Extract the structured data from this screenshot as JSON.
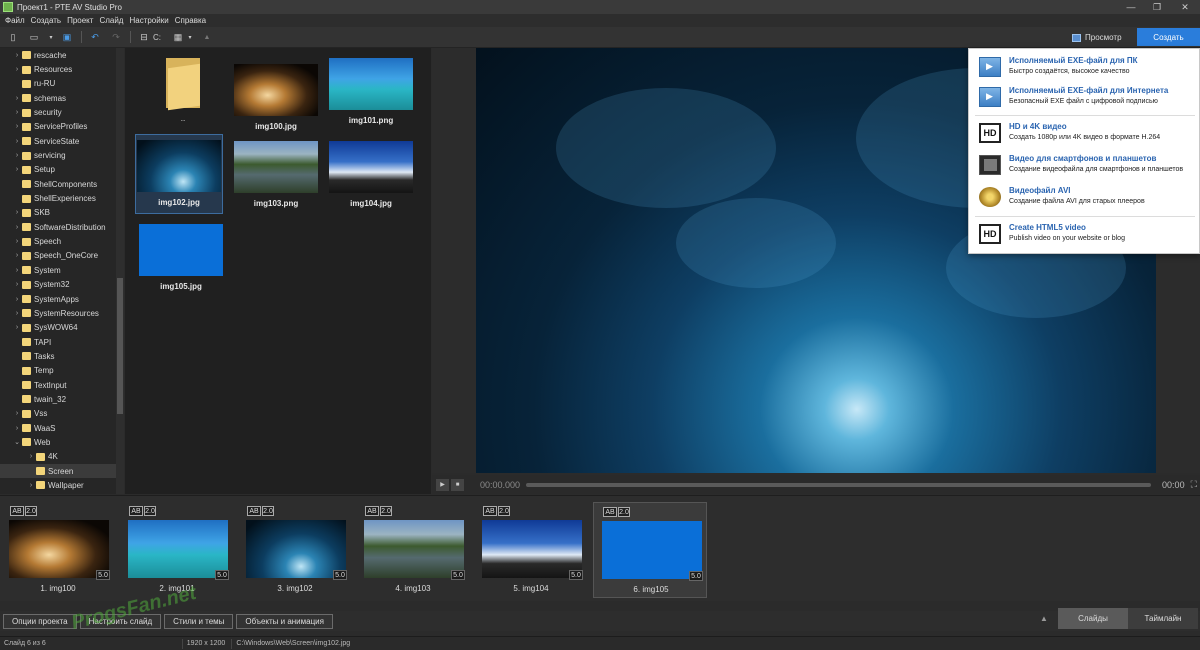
{
  "window": {
    "title": "Проект1 - PTE AV Studio Pro",
    "controls": [
      "—",
      "❐",
      "✕"
    ]
  },
  "menu": [
    "Файл",
    "Создать",
    "Проект",
    "Слайд",
    "Настройки",
    "Справка"
  ],
  "toolbar": {
    "drive_label": "C:",
    "preview_label": "Просмотр",
    "create_label": "Создать"
  },
  "tree": {
    "items": [
      {
        "label": "rescache",
        "arrow": "›"
      },
      {
        "label": "Resources",
        "arrow": "›"
      },
      {
        "label": "ru-RU",
        "arrow": ""
      },
      {
        "label": "schemas",
        "arrow": "›"
      },
      {
        "label": "security",
        "arrow": "›"
      },
      {
        "label": "ServiceProfiles",
        "arrow": "›"
      },
      {
        "label": "ServiceState",
        "arrow": "›"
      },
      {
        "label": "servicing",
        "arrow": "›"
      },
      {
        "label": "Setup",
        "arrow": "›"
      },
      {
        "label": "ShellComponents",
        "arrow": ""
      },
      {
        "label": "ShellExperiences",
        "arrow": ""
      },
      {
        "label": "SKB",
        "arrow": "›"
      },
      {
        "label": "SoftwareDistribution",
        "arrow": "›"
      },
      {
        "label": "Speech",
        "arrow": "›"
      },
      {
        "label": "Speech_OneCore",
        "arrow": "›"
      },
      {
        "label": "System",
        "arrow": "›"
      },
      {
        "label": "System32",
        "arrow": "›"
      },
      {
        "label": "SystemApps",
        "arrow": "›"
      },
      {
        "label": "SystemResources",
        "arrow": "›"
      },
      {
        "label": "SysWOW64",
        "arrow": "›"
      },
      {
        "label": "TAPI",
        "arrow": ""
      },
      {
        "label": "Tasks",
        "arrow": ""
      },
      {
        "label": "Temp",
        "arrow": ""
      },
      {
        "label": "TextInput",
        "arrow": ""
      },
      {
        "label": "twain_32",
        "arrow": ""
      },
      {
        "label": "Vss",
        "arrow": "›"
      },
      {
        "label": "WaaS",
        "arrow": "›"
      },
      {
        "label": "Web",
        "arrow": "⌄"
      },
      {
        "label": "4K",
        "arrow": "›"
      },
      {
        "label": "Screen",
        "arrow": ""
      },
      {
        "label": "Wallpaper",
        "arrow": "›"
      }
    ]
  },
  "files": [
    {
      "name": ".."
    },
    {
      "name": "img100.jpg"
    },
    {
      "name": "img101.png"
    },
    {
      "name": "img102.jpg"
    },
    {
      "name": "img103.png"
    },
    {
      "name": "img104.jpg"
    },
    {
      "name": "img105.jpg"
    }
  ],
  "player": {
    "time_current": "00:00.000",
    "time_end": "00:00"
  },
  "create_menu": [
    {
      "title": "Исполняемый EXE-файл для ПК",
      "subtitle": "Быстро создаётся, высокое качество",
      "icon": "exe-icon"
    },
    {
      "title": "Исполняемый EXE-файл для Интернета",
      "subtitle": "Безопасный EXE файл с цифровой подписью",
      "icon": "exe-web-icon"
    },
    {
      "title": "HD и 4K видео",
      "subtitle": "Создать 1080p или 4K видео в формате H.264",
      "icon": "hd-icon"
    },
    {
      "title": "Видео для смартфонов и планшетов",
      "subtitle": "Создание видеофайла для смартфонов и планшетов",
      "icon": "tablet-icon"
    },
    {
      "title": "Видеофайл AVI",
      "subtitle": "Создание файла AVI для старых плееров",
      "icon": "film-reel-icon"
    },
    {
      "title": "Create HTML5 video",
      "subtitle": "Publish video on your website or blog",
      "icon": "html5-hd-icon"
    }
  ],
  "hd_icon_text": "HD",
  "slides": [
    {
      "ab": "AB",
      "dur": "2.0",
      "time": "5.0",
      "caption": "1. img100"
    },
    {
      "ab": "AB",
      "dur": "2.0",
      "time": "5.0",
      "caption": "2. img101"
    },
    {
      "ab": "AB",
      "dur": "2.0",
      "time": "5.0",
      "caption": "3. img102"
    },
    {
      "ab": "AB",
      "dur": "2.0",
      "time": "5.0",
      "caption": "4. img103"
    },
    {
      "ab": "AB",
      "dur": "2.0",
      "time": "5.0",
      "caption": "5. img104"
    },
    {
      "ab": "AB",
      "dur": "2.0",
      "time": "5.0",
      "caption": "6. img105"
    }
  ],
  "bottom_buttons": [
    "Опции проекта",
    "Настроить слайд",
    "Стили и темы",
    "Объекты и анимация"
  ],
  "tabs": {
    "slides": "Слайды",
    "timeline": "Таймлайн"
  },
  "status": {
    "slide": "Слайд 6 из 6",
    "resolution": "1920 x 1200",
    "path": "C:\\Windows\\Web\\Screen\\img102.jpg"
  },
  "watermark": "ProgsFan.net",
  "colors": {
    "accent": "#2a7ddb",
    "link": "#2a64b0"
  }
}
